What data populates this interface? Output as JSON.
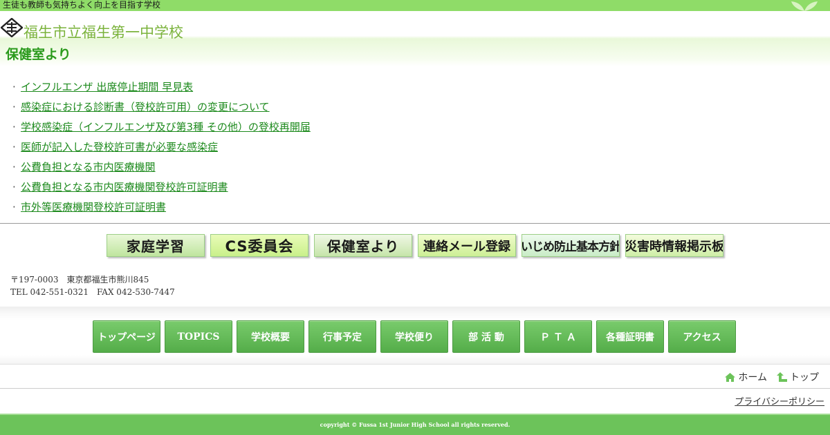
{
  "top_bar": {
    "tagline": "生徒も教師も気持ちよく向上を目指す学校"
  },
  "header": {
    "school_name": "福生市立福生第一中学校"
  },
  "page": {
    "title": "保健室より"
  },
  "links": [
    "インフルエンザ 出席停止期間 早見表",
    "感染症における診断書（登校許可用）の変更について",
    "学校感染症（インフルエンザ及び第3種 その他）の登校再開届",
    "医師が記入した登校許可書が必要な感染症",
    "公費負担となる市内医療機関",
    "公費負担となる市内医療機関登校許可証明書",
    "市外等医療機関登校許可証明書"
  ],
  "banners": [
    "家庭学習",
    "CS委員会",
    "保健室より",
    "連絡メール登録",
    "いじめ防止基本方針",
    "災害時情報掲示板"
  ],
  "address": {
    "line1": "〒197-0003　東京都福生市熊川845",
    "line2": "TEL 042-551-0321　FAX 042-530-7447"
  },
  "nav": [
    "トップページ",
    "TOPICS",
    "学校概要",
    "行事予定",
    "学校便り",
    "部 活 動",
    "Ｐ Ｔ Ａ",
    "各種証明書",
    "アクセス"
  ],
  "breadcrumb": {
    "home": "ホーム",
    "top": "トップ"
  },
  "privacy_label": "プライバシーポリシー",
  "copyright": "copyright © Fussa 1st Junior High School all rights reserved.",
  "colors": {
    "accent_green": "#6cc35a",
    "top_bar_green": "#8fdc68",
    "link_green": "#1d8a1d"
  },
  "icons": {
    "home": "home-icon",
    "top": "arrow-up-icon"
  }
}
